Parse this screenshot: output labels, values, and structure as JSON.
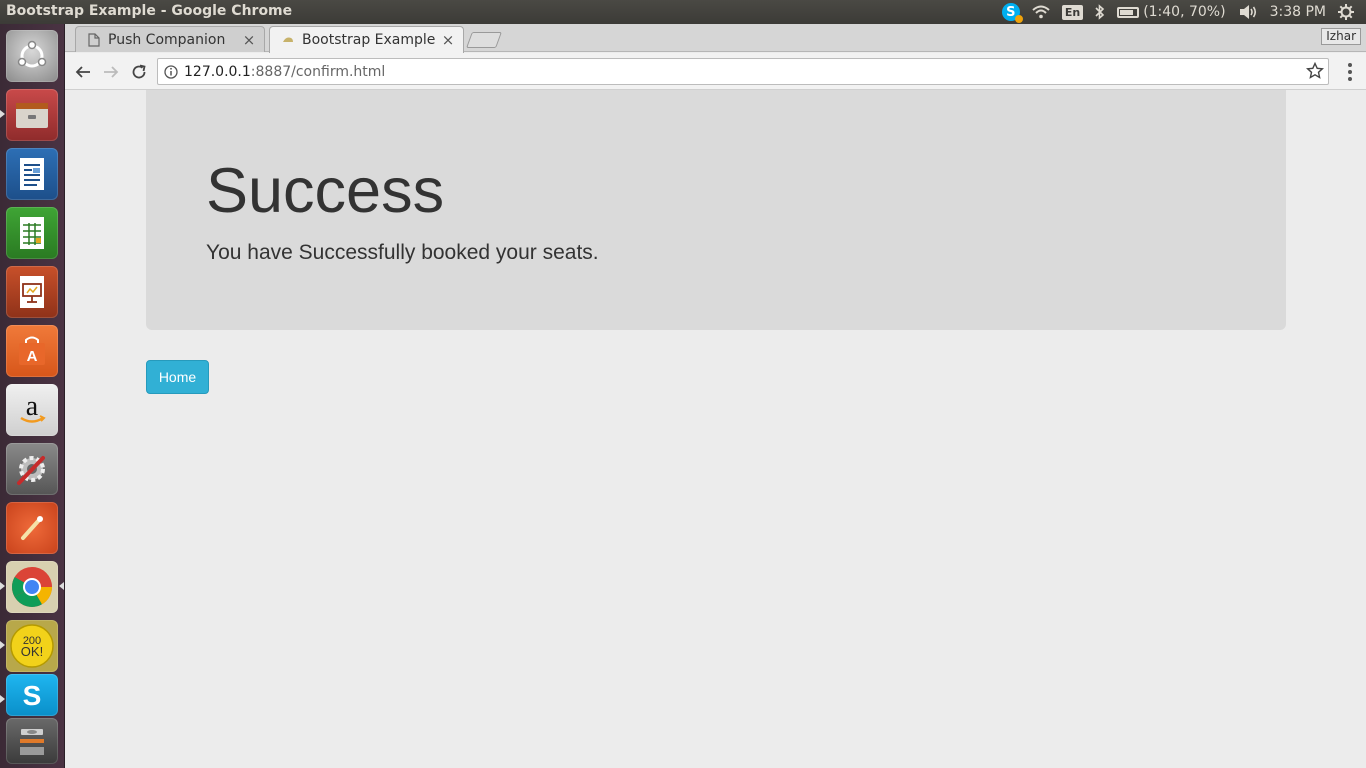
{
  "system": {
    "window_title": "Bootstrap Example - Google Chrome",
    "lang": "En",
    "battery": "(1:40, 70%)",
    "battery_level_percent": 70,
    "clock": "3:38 PM"
  },
  "launcher": {
    "items": [
      {
        "name": "ubuntu-dash-icon"
      },
      {
        "name": "files-icon"
      },
      {
        "name": "libreoffice-writer-icon"
      },
      {
        "name": "libreoffice-calc-icon"
      },
      {
        "name": "libreoffice-impress-icon"
      },
      {
        "name": "ubuntu-software-icon"
      },
      {
        "name": "amazon-icon"
      },
      {
        "name": "system-settings-icon"
      },
      {
        "name": "inkscape-icon"
      },
      {
        "name": "chrome-icon"
      },
      {
        "name": "200-ok-icon"
      },
      {
        "name": "skype-icon"
      },
      {
        "name": "trash-icon"
      }
    ]
  },
  "browser": {
    "tabs": [
      {
        "label": "Push Companion",
        "close": "×",
        "active": false
      },
      {
        "label": "Bootstrap Example",
        "close": "×",
        "active": true
      }
    ],
    "profile_name": "Izhar",
    "url_host": "127.0.0.1",
    "url_rest": ":8887/confirm.html"
  },
  "page": {
    "heading": "Success",
    "message": "You have Successfully booked your seats.",
    "home_button": "Home"
  },
  "colors": {
    "jumbotron_bg": "#dadada",
    "button_info": "#31b0d5",
    "page_bg": "#ececec"
  }
}
